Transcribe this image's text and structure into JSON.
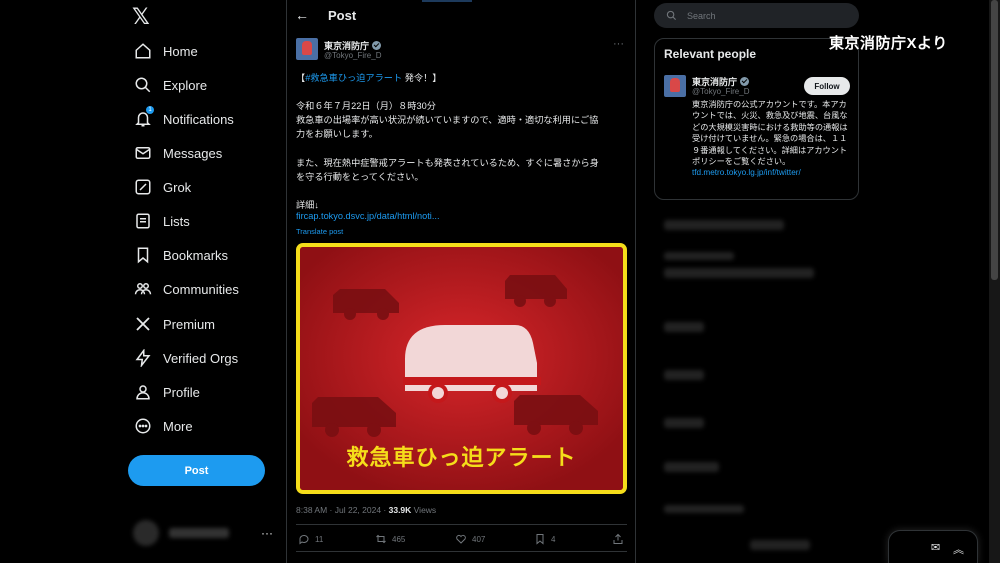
{
  "nav": {
    "logo": "𝕏",
    "items": [
      {
        "label": "Home",
        "icon": "home-icon"
      },
      {
        "label": "Explore",
        "icon": "search-icon"
      },
      {
        "label": "Notifications",
        "icon": "bell-icon"
      },
      {
        "label": "Messages",
        "icon": "mail-icon"
      },
      {
        "label": "Grok",
        "icon": "grok-icon"
      },
      {
        "label": "Lists",
        "icon": "list-icon"
      },
      {
        "label": "Bookmarks",
        "icon": "bookmark-icon"
      },
      {
        "label": "Communities",
        "icon": "people-icon"
      },
      {
        "label": "Premium",
        "icon": "x-icon"
      },
      {
        "label": "Verified Orgs",
        "icon": "lightning-icon"
      },
      {
        "label": "Profile",
        "icon": "person-icon"
      },
      {
        "label": "More",
        "icon": "more-circle-icon"
      }
    ],
    "notification_count": "1",
    "post_button": "Post",
    "account_more": "···"
  },
  "header": {
    "back": "←",
    "title": "Post"
  },
  "post": {
    "author_name": "東京消防庁",
    "author_handle": "@Tokyo_Fire_D",
    "more": "···",
    "line1_prefix": "【",
    "line1_hashtag": "#救急車ひっ迫アラート",
    "line1_suffix": " 発令！】",
    "line2": "令和６年７月22日（月）８時30分",
    "line3": "救急車の出場率が高い状況が続いていますので、適時・適切な利用にご協",
    "line4": "力をお願いします。",
    "line5": "また、現在熱中症警戒アラートも発表されているため、すぐに暑さから身",
    "line6": "を守る行動をとってください。",
    "line7": "詳細↓",
    "link": "fircap.tokyo.dsvc.jp/data/html/noti...",
    "translate": "Translate post",
    "image_text": "救急車ひっ迫アラート",
    "time": "8:38 AM · Jul 22, 2024 · ",
    "views_count": "33.9K",
    "views_label": " Views",
    "replies": "11",
    "reposts": "465",
    "likes": "407",
    "bookmarks": "4"
  },
  "search": {
    "placeholder": "Search"
  },
  "relevant": {
    "title": "Relevant people",
    "name": "東京消防庁",
    "handle": "@Tokyo_Fire_D",
    "follow": "Follow",
    "bio": "東京消防庁の公式アカウントです。本アカウントでは、火災、救急及び地震、台風などの大規模災害時における救助等の通報は受け付けていません。緊急の場合は、１１９番通報してください。詳細はアカウントポリシーをご覧ください。",
    "bio_link": "tfd.metro.tokyo.lg.jp/inf/twitter/"
  },
  "watermark": "東京消防庁Xより",
  "colors": {
    "accent": "#1d9bf0",
    "background": "#000000",
    "alert_red": "#c4181b",
    "alert_yellow": "#f5dd1a"
  }
}
